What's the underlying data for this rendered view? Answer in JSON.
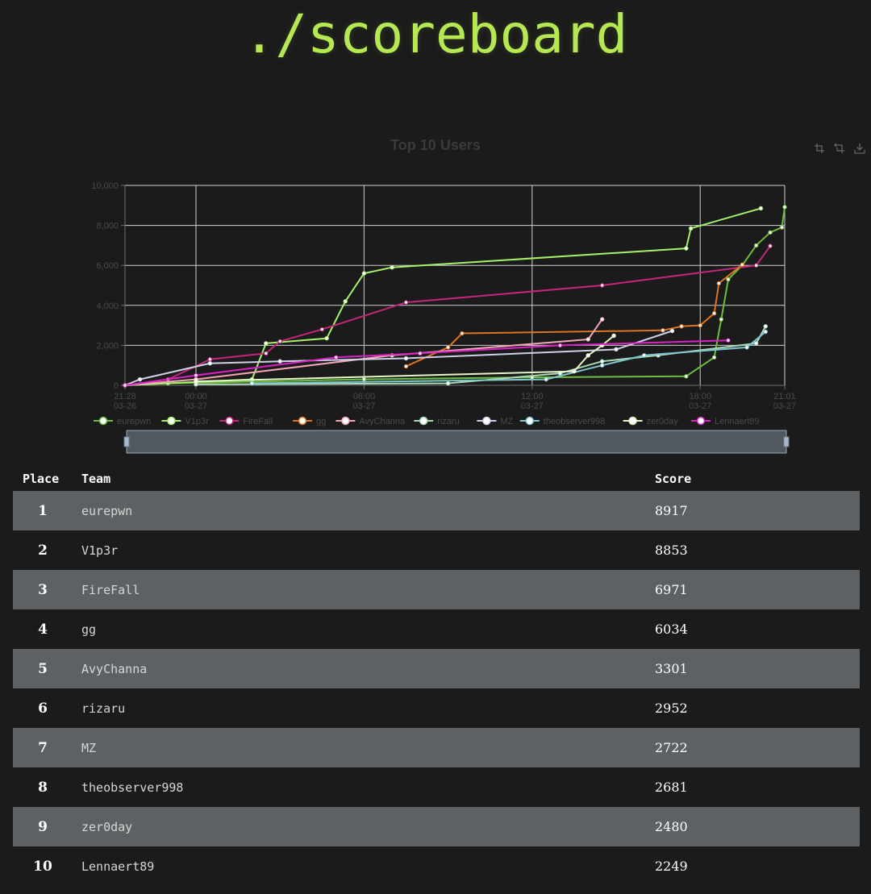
{
  "page": {
    "title": "./scoreboard"
  },
  "toolbox": {
    "icons": [
      "zoom-icon",
      "zoom-reset-icon",
      "save-image-icon"
    ]
  },
  "chart_data": {
    "type": "line",
    "title": "Top 10 Users",
    "y_ticks": [
      "0",
      "2,000",
      "4,000",
      "6,000",
      "8,000",
      "10,000"
    ],
    "ylim": [
      0,
      10000
    ],
    "xlim": [
      "2023-03-26 21:28",
      "2023-03-27 21:01"
    ],
    "x_ticks": [
      {
        "time": "21:28",
        "date": "03-26"
      },
      {
        "time": "00:00",
        "date": "03-27"
      },
      {
        "time": "06:00",
        "date": "03-27"
      },
      {
        "time": "12:00",
        "date": "03-27"
      },
      {
        "time": "18:00",
        "date": "03-27"
      },
      {
        "time": "21:01",
        "date": "03-27"
      }
    ],
    "x_tick_values": [
      "2023-03-26 21:28",
      "2023-03-27 00:00",
      "2023-03-27 06:00",
      "2023-03-27 12:00",
      "2023-03-27 18:00",
      "2023-03-27 21:01"
    ],
    "grid": true,
    "legend_position": "bottom",
    "series": [
      {
        "name": "eurepwn",
        "color": "#6fbd3f",
        "points": [
          [
            "2023-03-26 21:28",
            0
          ],
          [
            "2023-03-26 23:00",
            100
          ],
          [
            "2023-03-27 06:00",
            300
          ],
          [
            "2023-03-27 12:00",
            400
          ],
          [
            "2023-03-27 17:30",
            450
          ],
          [
            "2023-03-27 18:30",
            1400
          ],
          [
            "2023-03-27 18:45",
            3300
          ],
          [
            "2023-03-27 19:00",
            5300
          ],
          [
            "2023-03-27 19:30",
            6000
          ],
          [
            "2023-03-27 20:00",
            7000
          ],
          [
            "2023-03-27 20:30",
            7650
          ],
          [
            "2023-03-27 20:55",
            7900
          ],
          [
            "2023-03-27 21:01",
            8917
          ]
        ]
      },
      {
        "name": "V1p3r",
        "color": "#a6f06c",
        "points": [
          [
            "2023-03-26 21:28",
            0
          ],
          [
            "2023-03-27 02:00",
            300
          ],
          [
            "2023-03-27 02:30",
            2100
          ],
          [
            "2023-03-27 04:40",
            2350
          ],
          [
            "2023-03-27 05:20",
            4200
          ],
          [
            "2023-03-27 06:00",
            5600
          ],
          [
            "2023-03-27 07:00",
            5900
          ],
          [
            "2023-03-27 17:30",
            6850
          ],
          [
            "2023-03-27 17:40",
            7850
          ],
          [
            "2023-03-27 20:10",
            8853
          ]
        ]
      },
      {
        "name": "FireFall",
        "color": "#c7257a",
        "points": [
          [
            "2023-03-26 21:28",
            0
          ],
          [
            "2023-03-26 23:00",
            300
          ],
          [
            "2023-03-27 00:30",
            1300
          ],
          [
            "2023-03-27 02:30",
            1600
          ],
          [
            "2023-03-27 03:00",
            2200
          ],
          [
            "2023-03-27 04:30",
            2800
          ],
          [
            "2023-03-27 07:30",
            4150
          ],
          [
            "2023-03-27 14:30",
            5000
          ],
          [
            "2023-03-27 20:00",
            6000
          ],
          [
            "2023-03-27 20:30",
            6971
          ]
        ]
      },
      {
        "name": "gg",
        "color": "#e0741f",
        "points": [
          [
            "2023-03-27 07:30",
            950
          ],
          [
            "2023-03-27 09:00",
            1900
          ],
          [
            "2023-03-27 09:30",
            2600
          ],
          [
            "2023-03-27 16:40",
            2750
          ],
          [
            "2023-03-27 17:20",
            2950
          ],
          [
            "2023-03-27 18:00",
            3000
          ],
          [
            "2023-03-27 18:30",
            3600
          ],
          [
            "2023-03-27 18:40",
            5100
          ],
          [
            "2023-03-27 19:30",
            6034
          ]
        ]
      },
      {
        "name": "AvyChanna",
        "color": "#f2a7b4",
        "points": [
          [
            "2023-03-26 21:28",
            0
          ],
          [
            "2023-03-27 00:00",
            300
          ],
          [
            "2023-03-27 07:00",
            1500
          ],
          [
            "2023-03-27 14:00",
            2300
          ],
          [
            "2023-03-27 14:30",
            3301
          ]
        ]
      },
      {
        "name": "rizaru",
        "color": "#a9d9b5",
        "points": [
          [
            "2023-03-27 00:00",
            50
          ],
          [
            "2023-03-27 09:00",
            100
          ],
          [
            "2023-03-27 13:00",
            600
          ],
          [
            "2023-03-27 14:30",
            1200
          ],
          [
            "2023-03-27 16:30",
            1500
          ],
          [
            "2023-03-27 20:00",
            2100
          ],
          [
            "2023-03-27 20:20",
            2952
          ]
        ]
      },
      {
        "name": "MZ",
        "color": "#cdd2e8",
        "points": [
          [
            "2023-03-26 21:28",
            0
          ],
          [
            "2023-03-26 22:00",
            300
          ],
          [
            "2023-03-27 00:30",
            1100
          ],
          [
            "2023-03-27 03:00",
            1200
          ],
          [
            "2023-03-27 07:30",
            1350
          ],
          [
            "2023-03-27 15:00",
            1800
          ],
          [
            "2023-03-27 17:00",
            2722
          ]
        ]
      },
      {
        "name": "theobserver998",
        "color": "#7fc6cf",
        "points": [
          [
            "2023-03-27 02:00",
            100
          ],
          [
            "2023-03-27 12:30",
            300
          ],
          [
            "2023-03-27 14:30",
            1000
          ],
          [
            "2023-03-27 16:00",
            1500
          ],
          [
            "2023-03-27 19:40",
            1900
          ],
          [
            "2023-03-27 20:20",
            2681
          ]
        ]
      },
      {
        "name": "zer0day",
        "color": "#e4f5c8",
        "points": [
          [
            "2023-03-27 00:00",
            200
          ],
          [
            "2023-03-27 13:30",
            700
          ],
          [
            "2023-03-27 14:00",
            1500
          ],
          [
            "2023-03-27 14:30",
            2000
          ],
          [
            "2023-03-27 14:55",
            2480
          ]
        ]
      },
      {
        "name": "Lennaert89",
        "color": "#d923c4",
        "points": [
          [
            "2023-03-26 21:28",
            0
          ],
          [
            "2023-03-27 00:00",
            500
          ],
          [
            "2023-03-27 05:00",
            1400
          ],
          [
            "2023-03-27 08:00",
            1600
          ],
          [
            "2023-03-27 13:00",
            2000
          ],
          [
            "2023-03-27 19:00",
            2249
          ]
        ]
      }
    ]
  },
  "table": {
    "headers": {
      "place": "Place",
      "team": "Team",
      "score": "Score"
    },
    "rows": [
      {
        "place": "1",
        "team": "eurepwn",
        "score": "8917"
      },
      {
        "place": "2",
        "team": "V1p3r",
        "score": "8853"
      },
      {
        "place": "3",
        "team": "FireFall",
        "score": "6971"
      },
      {
        "place": "4",
        "team": "gg",
        "score": "6034"
      },
      {
        "place": "5",
        "team": "AvyChanna",
        "score": "3301"
      },
      {
        "place": "6",
        "team": "rizaru",
        "score": "2952"
      },
      {
        "place": "7",
        "team": "MZ",
        "score": "2722"
      },
      {
        "place": "8",
        "team": "theobserver998",
        "score": "2681"
      },
      {
        "place": "9",
        "team": "zer0day",
        "score": "2480"
      },
      {
        "place": "10",
        "team": "Lennaert89",
        "score": "2249"
      }
    ]
  }
}
